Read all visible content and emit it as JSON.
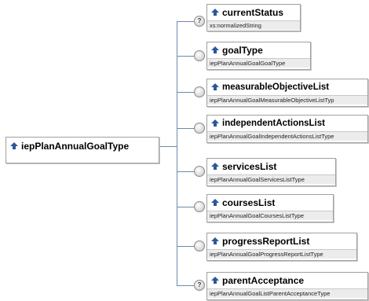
{
  "root": {
    "name": "iepPlanAnnualGoalType"
  },
  "children": [
    {
      "name": "currentStatus",
      "type": "xs:normalizedString",
      "marker": "?"
    },
    {
      "name": "goalType",
      "type": "iepPlanAnnualGoalGoalType",
      "marker": ""
    },
    {
      "name": "measurableObjectiveList",
      "type": "iepPlanAnnualGoalMeasurableObjectiveListTyp",
      "marker": ""
    },
    {
      "name": "independentActionsList",
      "type": "iepPlanAnnualGoalIndependentActionsListType",
      "marker": ""
    },
    {
      "name": "servicesList",
      "type": "iepPlanAnnualGoalServicesListType",
      "marker": ""
    },
    {
      "name": "coursesList",
      "type": "iepPlanAnnualGoalCoursesListType",
      "marker": ""
    },
    {
      "name": "progressReportList",
      "type": "iepPlanAnnualGoalProgressReportListType",
      "marker": ""
    },
    {
      "name": "parentAcceptance",
      "type": "iepPlanAnnualGoalListParentAcceptanceType",
      "marker": "?"
    }
  ],
  "colors": {
    "connector": "#6d88ad",
    "icon": "#2b5797"
  }
}
